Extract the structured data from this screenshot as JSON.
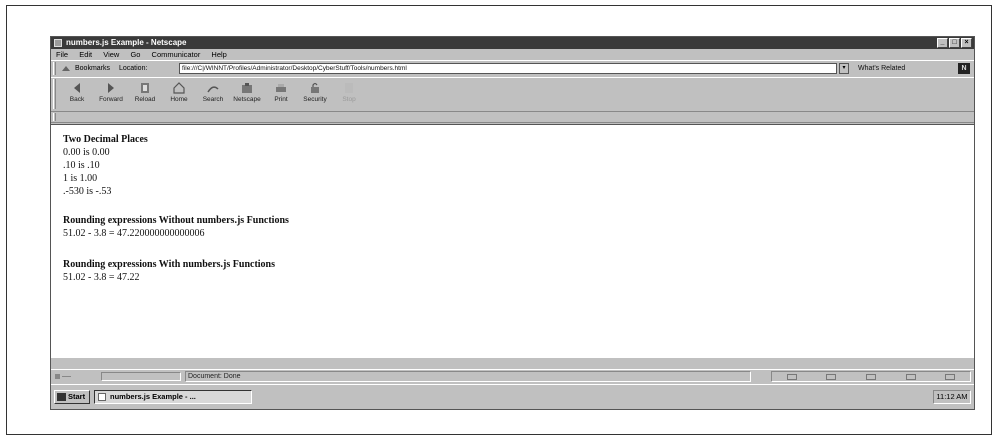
{
  "window": {
    "title": "numbers.js Example - Netscape",
    "buttons": [
      "minimize",
      "maximize",
      "close"
    ]
  },
  "menu": [
    "File",
    "Edit",
    "View",
    "Go",
    "Communicator",
    "Help"
  ],
  "location_bar": {
    "bookmarks_label": "Bookmarks",
    "location_label": "Location:",
    "url": "file:///C|/WINNT/Profiles/Administrator/Desktop/CyberStuff/Tools/numbers.html",
    "whats_related": "What's Related"
  },
  "toolbar": {
    "buttons": [
      {
        "label": "Back",
        "icon": "back-arrow-icon"
      },
      {
        "label": "Forward",
        "icon": "forward-arrow-icon"
      },
      {
        "label": "Reload",
        "icon": "reload-icon"
      },
      {
        "label": "Home",
        "icon": "home-icon"
      },
      {
        "label": "Search",
        "icon": "search-icon"
      },
      {
        "label": "Netscape",
        "icon": "netscape-icon"
      },
      {
        "label": "Print",
        "icon": "print-icon"
      },
      {
        "label": "Security",
        "icon": "security-lock-icon"
      },
      {
        "label": "Stop",
        "icon": "stop-icon"
      }
    ]
  },
  "content": {
    "section1": {
      "heading": "Two Decimal Places",
      "lines": [
        "0.00 is 0.00",
        ".10 is .10",
        "1 is 1.00",
        ".-530 is -.53"
      ]
    },
    "section2": {
      "heading": "Rounding expressions Without numbers.js Functions",
      "lines": [
        "51.02 - 3.8 = 47.220000000000006"
      ]
    },
    "section3": {
      "heading": "Rounding expressions With numbers.js Functions",
      "lines": [
        "51.02 - 3.8 = 47.22"
      ]
    }
  },
  "status": {
    "text": "Document: Done"
  },
  "taskbar": {
    "start": "Start",
    "task": "numbers.js Example - ...",
    "clock": "11:12 AM"
  }
}
